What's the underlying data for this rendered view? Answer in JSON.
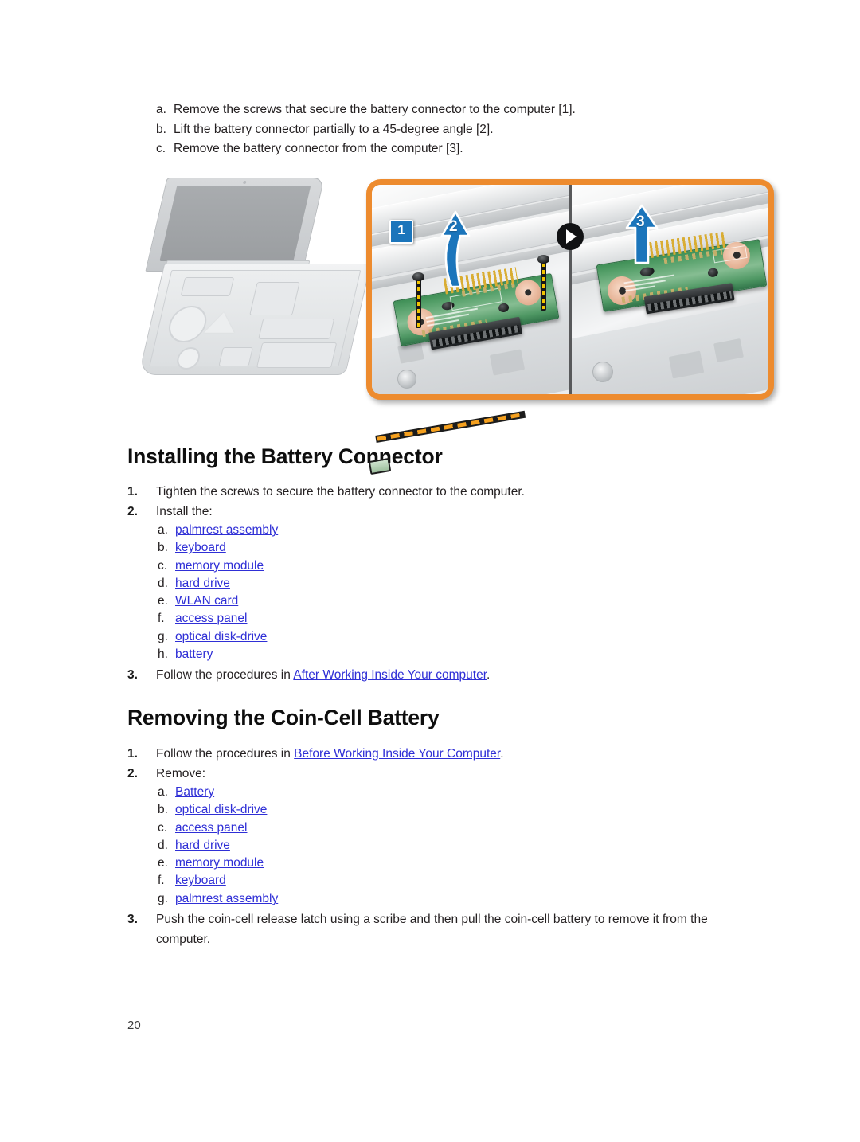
{
  "page": {
    "number": "20"
  },
  "top_steps": {
    "items": [
      {
        "marker": "a.",
        "text": "Remove the screws that secure the battery connector to the computer [1]."
      },
      {
        "marker": "b.",
        "text": "Lift the battery connector partially to a 45-degree angle [2]."
      },
      {
        "marker": "c.",
        "text": "Remove the battery connector from the computer [3]."
      }
    ]
  },
  "figure": {
    "callouts": [
      {
        "id": "callout-1",
        "label": "1",
        "kind": "box"
      },
      {
        "id": "callout-2",
        "label": "2",
        "kind": "arrow"
      },
      {
        "id": "callout-3",
        "label": "3",
        "kind": "arrow"
      }
    ],
    "play_icon": "play-icon",
    "zoom_pointer": "zoom-pointer-line"
  },
  "installing": {
    "title": "Installing the Battery Connector",
    "steps": [
      {
        "marker": "1.",
        "text": "Tighten the screws to secure the battery connector to the computer."
      },
      {
        "marker": "2.",
        "text": "Install the:"
      }
    ],
    "install_items": [
      {
        "marker": "a.",
        "label": "palmrest assembly"
      },
      {
        "marker": "b.",
        "label": "keyboard"
      },
      {
        "marker": "c.",
        "label": "memory module"
      },
      {
        "marker": "d.",
        "label": "hard drive"
      },
      {
        "marker": "e.",
        "label": "WLAN card"
      },
      {
        "marker": "f.",
        "label": "access panel"
      },
      {
        "marker": "g.",
        "label": "optical disk-drive"
      },
      {
        "marker": "h.",
        "label": "battery"
      }
    ],
    "step3": {
      "marker": "3.",
      "prefix": "Follow the procedures in ",
      "link": "After Working Inside Your computer",
      "suffix": "."
    }
  },
  "removing": {
    "title": "Removing the Coin-Cell Battery",
    "step1": {
      "marker": "1.",
      "prefix": "Follow the procedures in ",
      "link": "Before Working Inside Your Computer",
      "suffix": "."
    },
    "step2": {
      "marker": "2.",
      "text": "Remove:"
    },
    "remove_items": [
      {
        "marker": "a.",
        "label": "Battery"
      },
      {
        "marker": "b.",
        "label": "optical disk-drive"
      },
      {
        "marker": "c.",
        "label": "access panel"
      },
      {
        "marker": "d.",
        "label": "hard drive"
      },
      {
        "marker": "e.",
        "label": "memory module"
      },
      {
        "marker": "f.",
        "label": "keyboard"
      },
      {
        "marker": "g.",
        "label": "palmrest assembly"
      }
    ],
    "step3": {
      "marker": "3.",
      "text": "Push the coin-cell release latch using a scribe and then pull the coin-cell battery to remove it from the computer."
    }
  },
  "colors": {
    "link": "#2F2FD6",
    "callout_blue": "#1B75BB",
    "panel_border_orange": "#ED8B2E",
    "pcb_green": "#56A06A",
    "screw_yellow": "#F2C500"
  }
}
